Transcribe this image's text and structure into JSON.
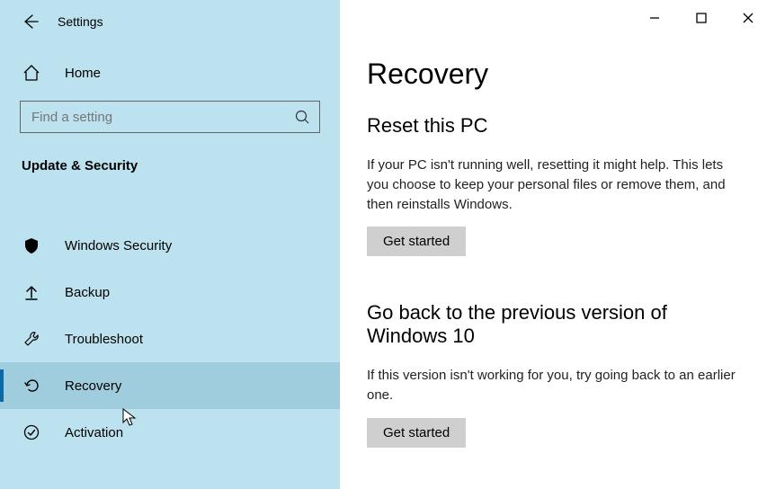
{
  "window": {
    "title": "Settings"
  },
  "sidebar": {
    "home": "Home",
    "search_placeholder": "Find a setting",
    "group": "Update & Security",
    "items": [
      {
        "label": "Windows Security"
      },
      {
        "label": "Backup"
      },
      {
        "label": "Troubleshoot"
      },
      {
        "label": "Recovery"
      },
      {
        "label": "Activation"
      }
    ]
  },
  "main": {
    "title": "Recovery",
    "reset": {
      "heading": "Reset this PC",
      "body": "If your PC isn't running well, resetting it might help. This lets you choose to keep your personal files or remove them, and then reinstalls Windows.",
      "button": "Get started"
    },
    "goback": {
      "heading": "Go back to the previous version of Windows 10",
      "body": "If this version isn't working for you, try going back to an earlier one.",
      "button": "Get started"
    }
  }
}
